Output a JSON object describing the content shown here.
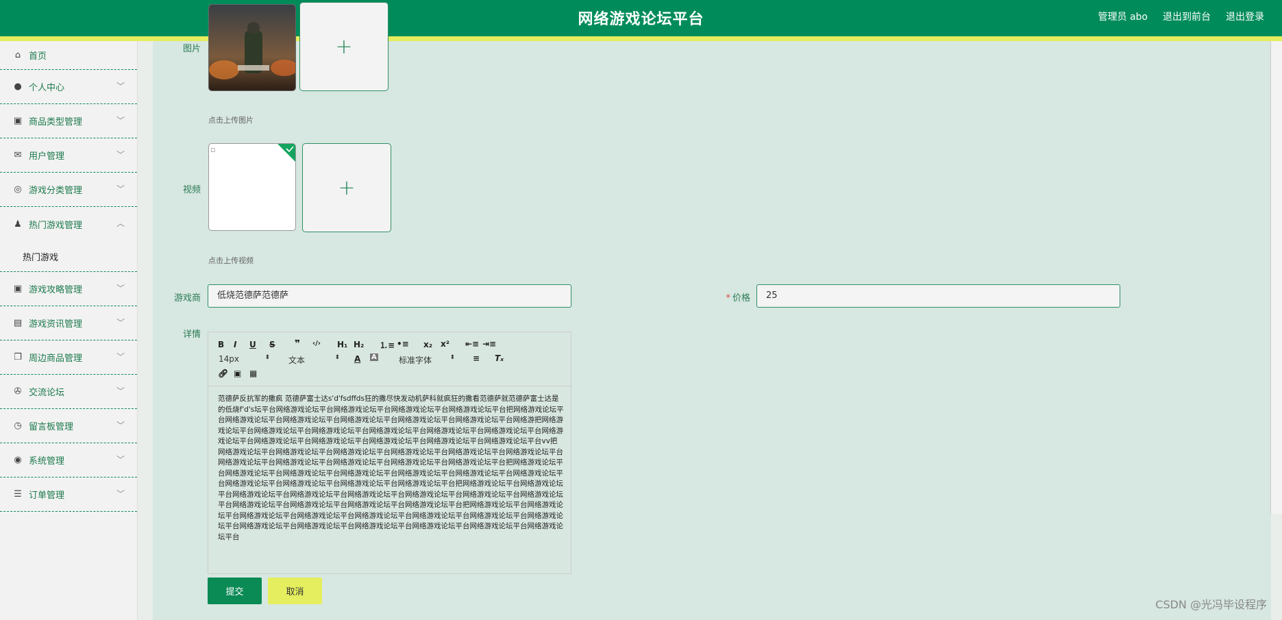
{
  "header": {
    "title": "网络游戏论坛平台",
    "user_label": "管理员 abo",
    "front_link": "退出到前台",
    "logout_link": "退出登录"
  },
  "sidebar": {
    "items": [
      {
        "label": "首页",
        "icon": "home-icon",
        "has_chevron": false
      },
      {
        "label": "个人中心",
        "icon": "user-icon",
        "has_chevron": true
      },
      {
        "label": "商品类型管理",
        "icon": "clipboard-icon",
        "has_chevron": true
      },
      {
        "label": "用户管理",
        "icon": "mail-icon",
        "has_chevron": true
      },
      {
        "label": "游戏分类管理",
        "icon": "compass-icon",
        "has_chevron": true
      },
      {
        "label": "热门游戏管理",
        "icon": "person-icon",
        "has_chevron": true,
        "expanded": true
      },
      {
        "label": "游戏攻略管理",
        "icon": "clipboard-icon",
        "has_chevron": true
      },
      {
        "label": "游戏资讯管理",
        "icon": "news-icon",
        "has_chevron": true
      },
      {
        "label": "周边商品管理",
        "icon": "copy-icon",
        "has_chevron": true
      },
      {
        "label": "交流论坛",
        "icon": "circle-icon",
        "has_chevron": true
      },
      {
        "label": "留言板管理",
        "icon": "clock-icon",
        "has_chevron": true
      },
      {
        "label": "系统管理",
        "icon": "target-icon",
        "has_chevron": true
      },
      {
        "label": "订单管理",
        "icon": "list-icon",
        "has_chevron": true
      }
    ],
    "sub_items": [
      {
        "label": "热门游戏"
      }
    ]
  },
  "form": {
    "image_label": "图片",
    "image_hint": "点击上传图片",
    "video_label": "视频",
    "video_hint": "点击上传视频",
    "developer_label": "游戏商",
    "developer_value": "低烧范德萨范德萨",
    "price_label": "价格",
    "price_value": "25",
    "detail_label": "详情",
    "submit_label": "提交",
    "cancel_label": "取消"
  },
  "editor": {
    "font_size": "14px",
    "block_type": "文本",
    "font_family": "标准字体",
    "content": "范德萨反抗军的撒疯 范德萨富士达s'd'fsdffds狂的撒尽快发动机萨科就疯狂的撒看范德萨就范德萨富士达是的低烧f'd's坛平台网络游戏论坛平台网络游戏论坛平台网络游戏论坛平台网络游戏论坛平台把网络游戏论坛平台网络游戏论坛平台网络游戏论坛平台网络游戏论坛平台网络游戏论坛平台网络游戏论坛平台网络游把网络游戏论坛平台网络游戏论坛平台网络游戏论坛平台网络游戏论坛平台网络游戏论坛平台网络游戏论坛平台网络游戏论坛平台网络游戏论坛平台网络游戏论坛平台网络游戏论坛平台网络游戏论坛平台网络游戏论坛平台vv把网络游戏论坛平台网络游戏论坛平台网络游戏论坛平台网络游戏论坛平台网络游戏论坛平台网络游戏论坛平台网络游戏论坛平台网络游戏论坛平台网络游戏论坛平台网络游戏论坛平台网络游戏论坛平台把网络游戏论坛平台网络游戏论坛平台网络游戏论坛平台网络游戏论坛平台网络游戏论坛平台网络游戏论坛平台网络游戏论坛平台网络游戏论坛平台网络游戏论坛平台网络游戏论坛平台网络游戏论坛平台把网络游戏论坛平台网络游戏论坛平台网络游戏论坛平台网络游戏论坛平台网络游戏论坛平台网络游戏论坛平台网络游戏论坛平台网络游戏论坛平台网络游戏论坛平台网络游戏论坛平台网络游戏论坛平台网络游戏论坛平台把网络游戏论坛平台网络游戏论坛平台网络游戏论坛平台网络游戏论坛平台网络游戏论坛平台网络游戏论坛平台网络游戏论坛平台网络游戏论坛平台网络游戏论坛平台网络游戏论坛平台网络游戏论坛平台网络游戏论坛平台网络游戏论坛平台网络游戏论坛平台"
  },
  "watermark": "CSDN @光冯毕设程序",
  "colors": {
    "header": "#008c5a",
    "accent_yellow": "#e4ee5e",
    "main_bg": "#d7e7e1"
  }
}
